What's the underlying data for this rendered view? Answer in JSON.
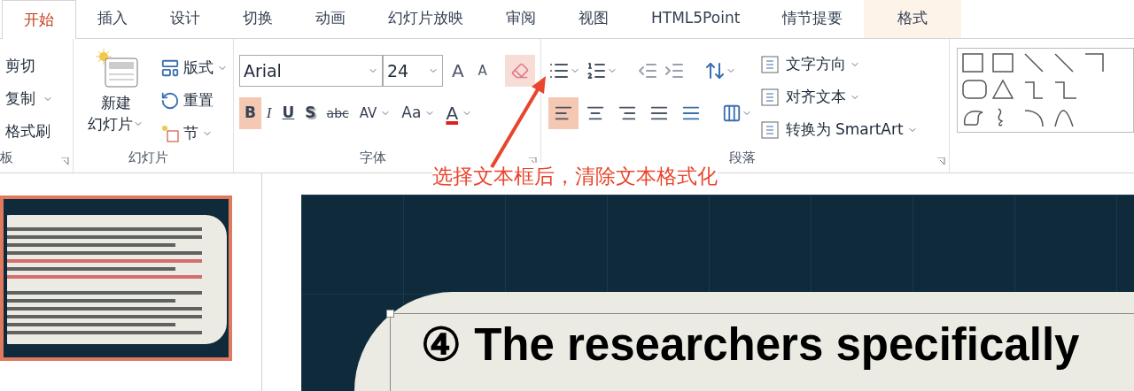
{
  "tabs": [
    {
      "label": "开始",
      "selected": true,
      "highlighted": false
    },
    {
      "label": "插入",
      "selected": false,
      "highlighted": false
    },
    {
      "label": "设计",
      "selected": false,
      "highlighted": false
    },
    {
      "label": "切换",
      "selected": false,
      "highlighted": false
    },
    {
      "label": "动画",
      "selected": false,
      "highlighted": false
    },
    {
      "label": "幻灯片放映",
      "selected": false,
      "highlighted": false
    },
    {
      "label": "审阅",
      "selected": false,
      "highlighted": false
    },
    {
      "label": "视图",
      "selected": false,
      "highlighted": false
    },
    {
      "label": "HTML5Point",
      "selected": false,
      "highlighted": false
    },
    {
      "label": "情节提要",
      "selected": false,
      "highlighted": false
    },
    {
      "label": "格式",
      "selected": false,
      "highlighted": true
    }
  ],
  "ribbon": {
    "clipboard": {
      "label": "板",
      "items": [
        {
          "label": "剪切",
          "dropdown": false
        },
        {
          "label": "复制",
          "dropdown": true
        },
        {
          "label": "格式刷",
          "dropdown": false
        }
      ]
    },
    "slides": {
      "label": "幻灯片",
      "new_slide": [
        "新建",
        "幻灯片"
      ],
      "items": [
        {
          "kind": "layout",
          "label": "版式",
          "dropdown": true
        },
        {
          "kind": "reset",
          "label": "重置",
          "dropdown": false
        },
        {
          "kind": "section",
          "label": "节",
          "dropdown": true
        }
      ]
    },
    "font": {
      "label": "字体",
      "font_name": "Arial",
      "font_size": "24",
      "grow": "A",
      "shrink": "A",
      "clear_formatting": {
        "selected": true
      },
      "styles": [
        {
          "kind": "bold",
          "label": "B",
          "selected": true,
          "dropdown": false
        },
        {
          "kind": "italic",
          "label": "I",
          "selected": false,
          "dropdown": false
        },
        {
          "kind": "underline",
          "label": "U",
          "selected": false,
          "dropdown": false
        },
        {
          "kind": "shadow",
          "label": "S",
          "selected": false,
          "dropdown": false
        },
        {
          "kind": "strike",
          "label": "abc",
          "selected": false,
          "dropdown": false
        },
        {
          "kind": "spacing",
          "label": "AV",
          "selected": false,
          "dropdown": true
        },
        {
          "kind": "case",
          "label": "Aa",
          "selected": false,
          "dropdown": true
        },
        {
          "kind": "color",
          "label": "A",
          "selected": false,
          "dropdown": true
        }
      ]
    },
    "paragraph": {
      "label": "段落",
      "alignment": [
        {
          "kind": "left",
          "selected": true
        },
        {
          "kind": "center",
          "selected": false
        },
        {
          "kind": "right",
          "selected": false
        },
        {
          "kind": "justify",
          "selected": false
        },
        {
          "kind": "distributed",
          "selected": false
        }
      ],
      "text_direction": "文字方向",
      "align_text": "对齐文本",
      "smartart": "转换为 SmartArt"
    }
  },
  "annotation": "选择文本框后，清除文本格式化",
  "slide": {
    "heading": "④ The researchers specifically"
  }
}
